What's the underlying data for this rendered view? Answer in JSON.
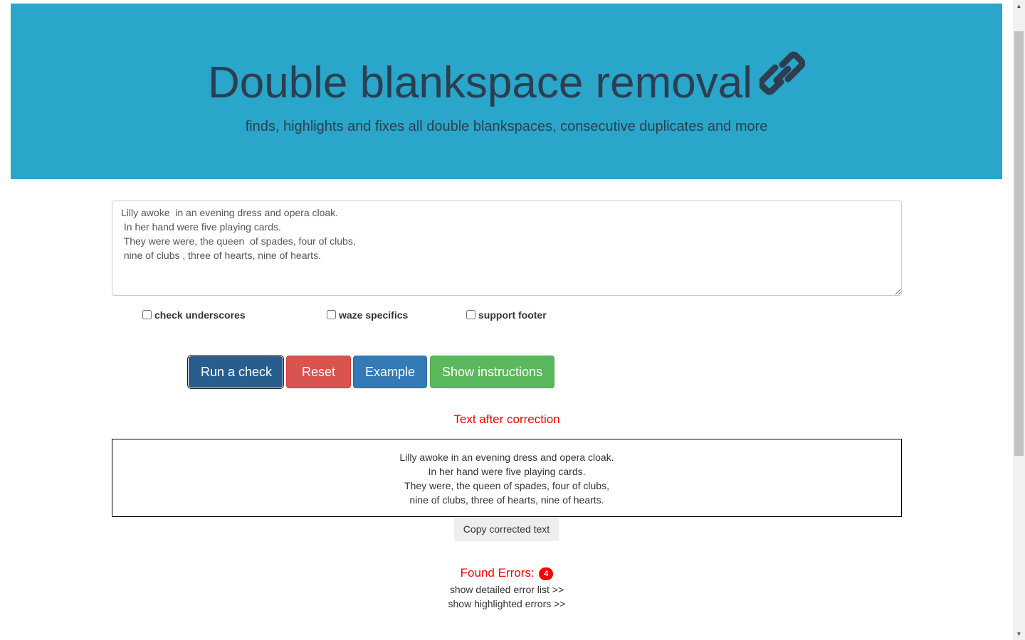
{
  "hero": {
    "title": "Double blankspace removal",
    "title_icon": "link-icon",
    "subtitle": "finds, highlights and fixes all double blankspaces, consecutive duplicates and more"
  },
  "input": {
    "value": "Lilly awoke  in an evening dress and opera cloak.\n In her hand were five playing cards.\n They were were, the queen  of spades, four of clubs,\n nine of clubs , three of hearts, nine of hearts."
  },
  "options": [
    {
      "label": "check underscores",
      "checked": false
    },
    {
      "label": "waze specifics",
      "checked": false
    },
    {
      "label": "support footer",
      "checked": false
    }
  ],
  "buttons": {
    "run": "Run a check",
    "reset": "Reset",
    "example": "Example",
    "instructions": "Show instructions"
  },
  "result": {
    "title": "Text after correction",
    "lines": [
      "Lilly awoke in an evening dress and opera cloak.",
      "In her hand were five playing cards.",
      "They were, the queen of spades, four of clubs,",
      "nine of clubs, three of hearts, nine of hearts."
    ],
    "copy_label": "Copy corrected text"
  },
  "errors": {
    "label": "Found Errors:",
    "count": "4",
    "detailed_link": "show detailed error list >>",
    "highlighted_link": "show highlighted errors >>"
  },
  "colors": {
    "hero_bg": "#29a6ca",
    "hero_text": "#2d3e50",
    "accent_red": "#ff0000",
    "btn_primary_dark": "#285e8e",
    "btn_danger": "#d9534f",
    "btn_primary": "#337ab7",
    "btn_success": "#5cb85c"
  }
}
